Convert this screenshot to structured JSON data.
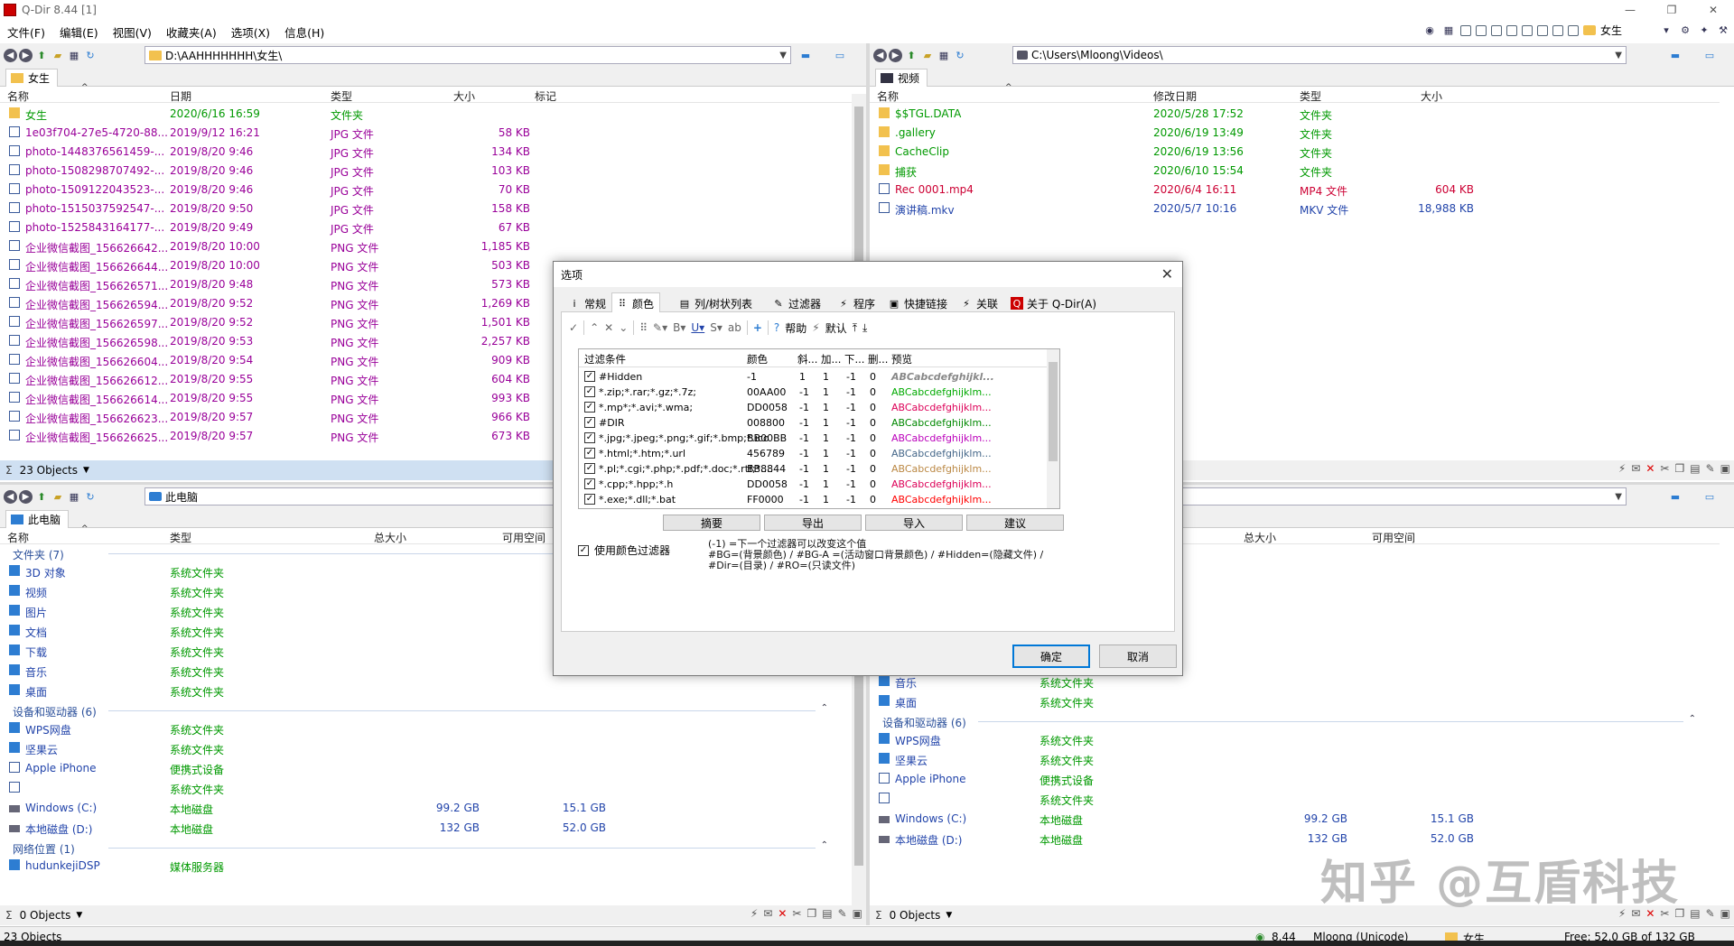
{
  "window": {
    "title": "Q-Dir 8.44 [1]",
    "controls": [
      "—",
      "❐",
      "✕"
    ]
  },
  "menu": [
    "文件(F)",
    "编辑(E)",
    "视图(V)",
    "收藏夹(A)",
    "选项(X)",
    "信息(H)"
  ],
  "menu_right": {
    "label": "女生"
  },
  "panes": {
    "tl": {
      "address": "D:\\AAHHHHHHH\\女生\\",
      "tab": "女生",
      "headers": [
        "名称",
        "日期",
        "类型",
        "大小",
        "标记"
      ],
      "rows": [
        {
          "name": "女生",
          "date": "2020/6/16 16:59",
          "type": "文件夹",
          "size": "",
          "kind": "folder",
          "color": "g"
        },
        {
          "name": "1e03f704-27e5-4720-88...",
          "date": "2019/9/12 16:21",
          "type": "JPG 文件",
          "size": "58 KB",
          "kind": "doc",
          "color": "p"
        },
        {
          "name": "photo-1448376561459-...",
          "date": "2019/8/20 9:46",
          "type": "JPG 文件",
          "size": "134 KB",
          "kind": "doc",
          "color": "p"
        },
        {
          "name": "photo-1508298707492-...",
          "date": "2019/8/20 9:46",
          "type": "JPG 文件",
          "size": "103 KB",
          "kind": "doc",
          "color": "p"
        },
        {
          "name": "photo-1509122043523-...",
          "date": "2019/8/20 9:46",
          "type": "JPG 文件",
          "size": "70 KB",
          "kind": "doc",
          "color": "p"
        },
        {
          "name": "photo-1515037592547-...",
          "date": "2019/8/20 9:50",
          "type": "JPG 文件",
          "size": "158 KB",
          "kind": "doc",
          "color": "p"
        },
        {
          "name": "photo-1525843164177-...",
          "date": "2019/8/20 9:49",
          "type": "JPG 文件",
          "size": "67 KB",
          "kind": "doc",
          "color": "p"
        },
        {
          "name": "企业微信截图_156626642...",
          "date": "2019/8/20 10:00",
          "type": "PNG 文件",
          "size": "1,185 KB",
          "kind": "doc",
          "color": "p"
        },
        {
          "name": "企业微信截图_156626644...",
          "date": "2019/8/20 10:00",
          "type": "PNG 文件",
          "size": "503 KB",
          "kind": "doc",
          "color": "p"
        },
        {
          "name": "企业微信截图_156626571...",
          "date": "2019/8/20 9:48",
          "type": "PNG 文件",
          "size": "573 KB",
          "kind": "doc",
          "color": "p"
        },
        {
          "name": "企业微信截图_156626594...",
          "date": "2019/8/20 9:52",
          "type": "PNG 文件",
          "size": "1,269 KB",
          "kind": "doc",
          "color": "p"
        },
        {
          "name": "企业微信截图_156626597...",
          "date": "2019/8/20 9:52",
          "type": "PNG 文件",
          "size": "1,501 KB",
          "kind": "doc",
          "color": "p"
        },
        {
          "name": "企业微信截图_156626598...",
          "date": "2019/8/20 9:53",
          "type": "PNG 文件",
          "size": "2,257 KB",
          "kind": "doc",
          "color": "p"
        },
        {
          "name": "企业微信截图_156626604...",
          "date": "2019/8/20 9:54",
          "type": "PNG 文件",
          "size": "909 KB",
          "kind": "doc",
          "color": "p"
        },
        {
          "name": "企业微信截图_156626612...",
          "date": "2019/8/20 9:55",
          "type": "PNG 文件",
          "size": "604 KB",
          "kind": "doc",
          "color": "p"
        },
        {
          "name": "企业微信截图_156626614...",
          "date": "2019/8/20 9:55",
          "type": "PNG 文件",
          "size": "993 KB",
          "kind": "doc",
          "color": "p"
        },
        {
          "name": "企业微信截图_156626623...",
          "date": "2019/8/20 9:57",
          "type": "PNG 文件",
          "size": "966 KB",
          "kind": "doc",
          "color": "p"
        },
        {
          "name": "企业微信截图_156626625...",
          "date": "2019/8/20 9:57",
          "type": "PNG 文件",
          "size": "673 KB",
          "kind": "doc",
          "color": "p"
        }
      ],
      "status": "23 Objects"
    },
    "tr": {
      "address": "C:\\Users\\Mloong\\Videos\\",
      "tab": "视频",
      "headers": [
        "名称",
        "修改日期",
        "类型",
        "大小"
      ],
      "rows": [
        {
          "name": "$$TGL.DATA",
          "date": "2020/5/28 17:52",
          "type": "文件夹",
          "size": "",
          "kind": "folder",
          "color": "g"
        },
        {
          "name": ".gallery",
          "date": "2020/6/19 13:49",
          "type": "文件夹",
          "size": "",
          "kind": "folder",
          "color": "g"
        },
        {
          "name": "CacheClip",
          "date": "2020/6/19 13:56",
          "type": "文件夹",
          "size": "",
          "kind": "folder",
          "color": "g"
        },
        {
          "name": "捕获",
          "date": "2020/6/10 15:54",
          "type": "文件夹",
          "size": "",
          "kind": "folder",
          "color": "g"
        },
        {
          "name": "Rec 0001.mp4",
          "date": "2020/6/4 16:11",
          "type": "MP4 文件",
          "size": "604 KB",
          "kind": "doc",
          "color": "r"
        },
        {
          "name": "演讲稿.mkv",
          "date": "2020/5/7 10:16",
          "type": "MKV 文件",
          "size": "18,988 KB",
          "kind": "doc",
          "color": "b"
        }
      ]
    },
    "bl": {
      "address": "此电脑",
      "tab": "此电脑",
      "headers": [
        "名称",
        "类型",
        "总大小",
        "可用空间"
      ],
      "groups": [
        {
          "title": "文件夹 (7)",
          "items": [
            {
              "name": "3D 对象",
              "type": "系统文件夹",
              "total": "",
              "free": ""
            },
            {
              "name": "视频",
              "type": "系统文件夹",
              "total": "",
              "free": ""
            },
            {
              "name": "图片",
              "type": "系统文件夹",
              "total": "",
              "free": ""
            },
            {
              "name": "文档",
              "type": "系统文件夹",
              "total": "",
              "free": ""
            },
            {
              "name": "下载",
              "type": "系统文件夹",
              "total": "",
              "free": ""
            },
            {
              "name": "音乐",
              "type": "系统文件夹",
              "total": "",
              "free": ""
            },
            {
              "name": "桌面",
              "type": "系统文件夹",
              "total": "",
              "free": ""
            }
          ]
        },
        {
          "title": "设备和驱动器 (6)",
          "items": [
            {
              "name": "WPS网盘",
              "type": "系统文件夹",
              "total": "",
              "free": ""
            },
            {
              "name": "坚果云",
              "type": "系统文件夹",
              "total": "",
              "free": ""
            },
            {
              "name": "Apple iPhone",
              "type": "便携式设备",
              "total": "",
              "free": ""
            },
            {
              "name": "",
              "type": "系统文件夹",
              "total": "",
              "free": ""
            },
            {
              "name": "Windows (C:)",
              "type": "本地磁盘",
              "total": "99.2 GB",
              "free": "15.1 GB"
            },
            {
              "name": "本地磁盘 (D:)",
              "type": "本地磁盘",
              "total": "132 GB",
              "free": "52.0 GB"
            }
          ]
        },
        {
          "title": "网络位置 (1)",
          "items": [
            {
              "name": "hudunkejiDSP",
              "type": "媒体服务器",
              "total": "",
              "free": ""
            }
          ]
        }
      ],
      "status": "0 Objects"
    },
    "br": {
      "headers": [
        "总大小",
        "可用空间"
      ],
      "items_music": [
        {
          "name": "音乐",
          "type": "系统文件夹"
        },
        {
          "name": "桌面",
          "type": "系统文件夹"
        }
      ],
      "group2": "设备和驱动器 (6)",
      "items": [
        {
          "name": "WPS网盘",
          "type": "系统文件夹",
          "total": "",
          "free": ""
        },
        {
          "name": "坚果云",
          "type": "系统文件夹",
          "total": "",
          "free": ""
        },
        {
          "name": "Apple iPhone",
          "type": "便携式设备",
          "total": "",
          "free": ""
        },
        {
          "name": "",
          "type": "系统文件夹",
          "total": "",
          "free": ""
        },
        {
          "name": "Windows (C:)",
          "type": "本地磁盘",
          "total": "99.2 GB",
          "free": "15.1 GB"
        },
        {
          "name": "本地磁盘 (D:)",
          "type": "本地磁盘",
          "total": "132 GB",
          "free": "52.0 GB"
        }
      ],
      "status": "0 Objects"
    }
  },
  "statusbar": {
    "left": "23 Objects",
    "ver": "8.44",
    "user": "Mloong (Unicode)",
    "folder": "女生",
    "free": "Free: 52.0 GB of 132 GB"
  },
  "dialog": {
    "title": "选项",
    "tabs": [
      "常规",
      "颜色",
      "列/树状列表",
      "过滤器",
      "程序",
      "快捷链接",
      "关联",
      "关于 Q-Dir(A)"
    ],
    "toolbar": {
      "help": "帮助",
      "default": "默认"
    },
    "headers": [
      "过滤条件",
      "颜色",
      "斜...",
      "加...",
      "下...",
      "删...",
      "预览"
    ],
    "rows": [
      {
        "f": "#Hidden",
        "c": "-1",
        "a": "1",
        "b": "1",
        "u": "-1",
        "d": "0",
        "p": "ABCabcdefghijkl...",
        "pc": "#888888"
      },
      {
        "f": "*.zip;*.rar;*.gz;*.7z;",
        "c": "00AA00",
        "a": "-1",
        "b": "1",
        "u": "-1",
        "d": "0",
        "p": "ABCabcdefghijklm...",
        "pc": "#00AA00"
      },
      {
        "f": "*.mp*;*.avi;*.wma;",
        "c": "DD0058",
        "a": "-1",
        "b": "1",
        "u": "-1",
        "d": "0",
        "p": "ABCabcdefghijklm...",
        "pc": "#DD0058"
      },
      {
        "f": "#DIR",
        "c": "008800",
        "a": "-1",
        "b": "1",
        "u": "-1",
        "d": "0",
        "p": "ABCabcdefghijklm...",
        "pc": "#008800"
      },
      {
        "f": "*.jpg;*.jpeg;*.png;*.gif;*.bmp;*.ico",
        "c": "BB00BB",
        "a": "-1",
        "b": "1",
        "u": "-1",
        "d": "0",
        "p": "ABCabcdefghijklm...",
        "pc": "#BB00BB"
      },
      {
        "f": "*.html;*.htm;*.url",
        "c": "456789",
        "a": "-1",
        "b": "1",
        "u": "-1",
        "d": "0",
        "p": "ABCabcdefghijklm...",
        "pc": "#456789"
      },
      {
        "f": "*.pl;*.cgi;*.php;*.pdf;*.doc;*.rtf;*....",
        "c": "BB8844",
        "a": "-1",
        "b": "1",
        "u": "-1",
        "d": "0",
        "p": "ABCabcdefghijklm...",
        "pc": "#BB8844"
      },
      {
        "f": "*.cpp;*.hpp;*.h",
        "c": "DD0058",
        "a": "-1",
        "b": "1",
        "u": "-1",
        "d": "0",
        "p": "ABCabcdefghijklm...",
        "pc": "#DD0058"
      },
      {
        "f": "*.exe;*.dll;*.bat",
        "c": "FF0000",
        "a": "-1",
        "b": "1",
        "u": "-1",
        "d": "0",
        "p": "ABCabcdefghijklm...",
        "pc": "#FF0000"
      }
    ],
    "buttons": [
      "摘要",
      "导出",
      "导入",
      "建议"
    ],
    "use_filter": "使用颜色过滤器",
    "hint": "(-1) =下一个过滤器可以改变这个值\n#BG=(背景颜色) / #BG-A =(活动窗口背景颜色) / #Hidden=(隐藏文件) / #Dir=(目录) / #RO=(只读文件)",
    "ok": "确定",
    "cancel": "取消"
  },
  "watermark": "知乎 @互盾科技",
  "colors": {
    "green": "#009900",
    "purple": "#990099",
    "blue": "#2244aa",
    "red": "#cc0033",
    "status_blue": "#cfe0f2"
  }
}
